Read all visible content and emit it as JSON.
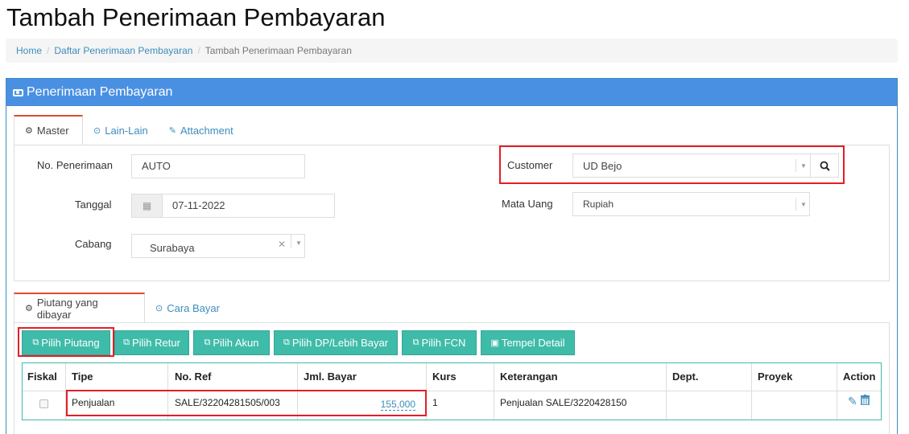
{
  "page": {
    "title": "Tambah Penerimaan Pembayaran"
  },
  "breadcrumb": {
    "home": "Home",
    "list": "Daftar Penerimaan Pembayaran",
    "current": "Tambah Penerimaan Pembayaran"
  },
  "panel": {
    "title": "Penerimaan Pembayaran"
  },
  "tabs": {
    "master": "Master",
    "lain": "Lain-Lain",
    "attachment": "Attachment"
  },
  "form": {
    "no_label": "No. Penerimaan",
    "no_value": "AUTO",
    "tanggal_label": "Tanggal",
    "tanggal_value": "07-11-2022",
    "cabang_label": "Cabang",
    "cabang_value": "Surabaya",
    "customer_label": "Customer",
    "customer_value": "UD Bejo",
    "mata_uang_label": "Mata Uang",
    "mata_uang_value": "Rupiah"
  },
  "subtabs": {
    "piutang": "Piutang yang dibayar",
    "cara_bayar": "Cara Bayar"
  },
  "buttons": {
    "pilih_piutang": "Pilih Piutang",
    "pilih_retur": "Pilih Retur",
    "pilih_akun": "Pilih Akun",
    "pilih_dp": "Pilih DP/Lebih Bayar",
    "pilih_fcn": "Pilih FCN",
    "tempel_detail": "Tempel Detail"
  },
  "table": {
    "headers": {
      "fiskal": "Fiskal",
      "tipe": "Tipe",
      "no_ref": "No. Ref",
      "jml_bayar": "Jml. Bayar",
      "kurs": "Kurs",
      "keterangan": "Keterangan",
      "dept": "Dept.",
      "proyek": "Proyek",
      "action": "Action"
    },
    "rows": [
      {
        "tipe": "Penjualan",
        "no_ref": "SALE/32204281505/003",
        "jml_bayar": "155,000",
        "kurs": "1",
        "keterangan": "Penjualan SALE/3220428150",
        "dept": "",
        "proyek": ""
      }
    ]
  },
  "colors": {
    "accent": "#4a90e2",
    "teal": "#3fbba9",
    "highlight": "#e41e26"
  },
  "icons": {
    "panel": "money-icon",
    "master": "gears-icon",
    "lain": "check-circle-icon",
    "attachment": "paperclip-icon",
    "calendar": "calendar-icon",
    "search": "search-icon",
    "edit": "pencil-icon",
    "delete": "trash-icon"
  }
}
